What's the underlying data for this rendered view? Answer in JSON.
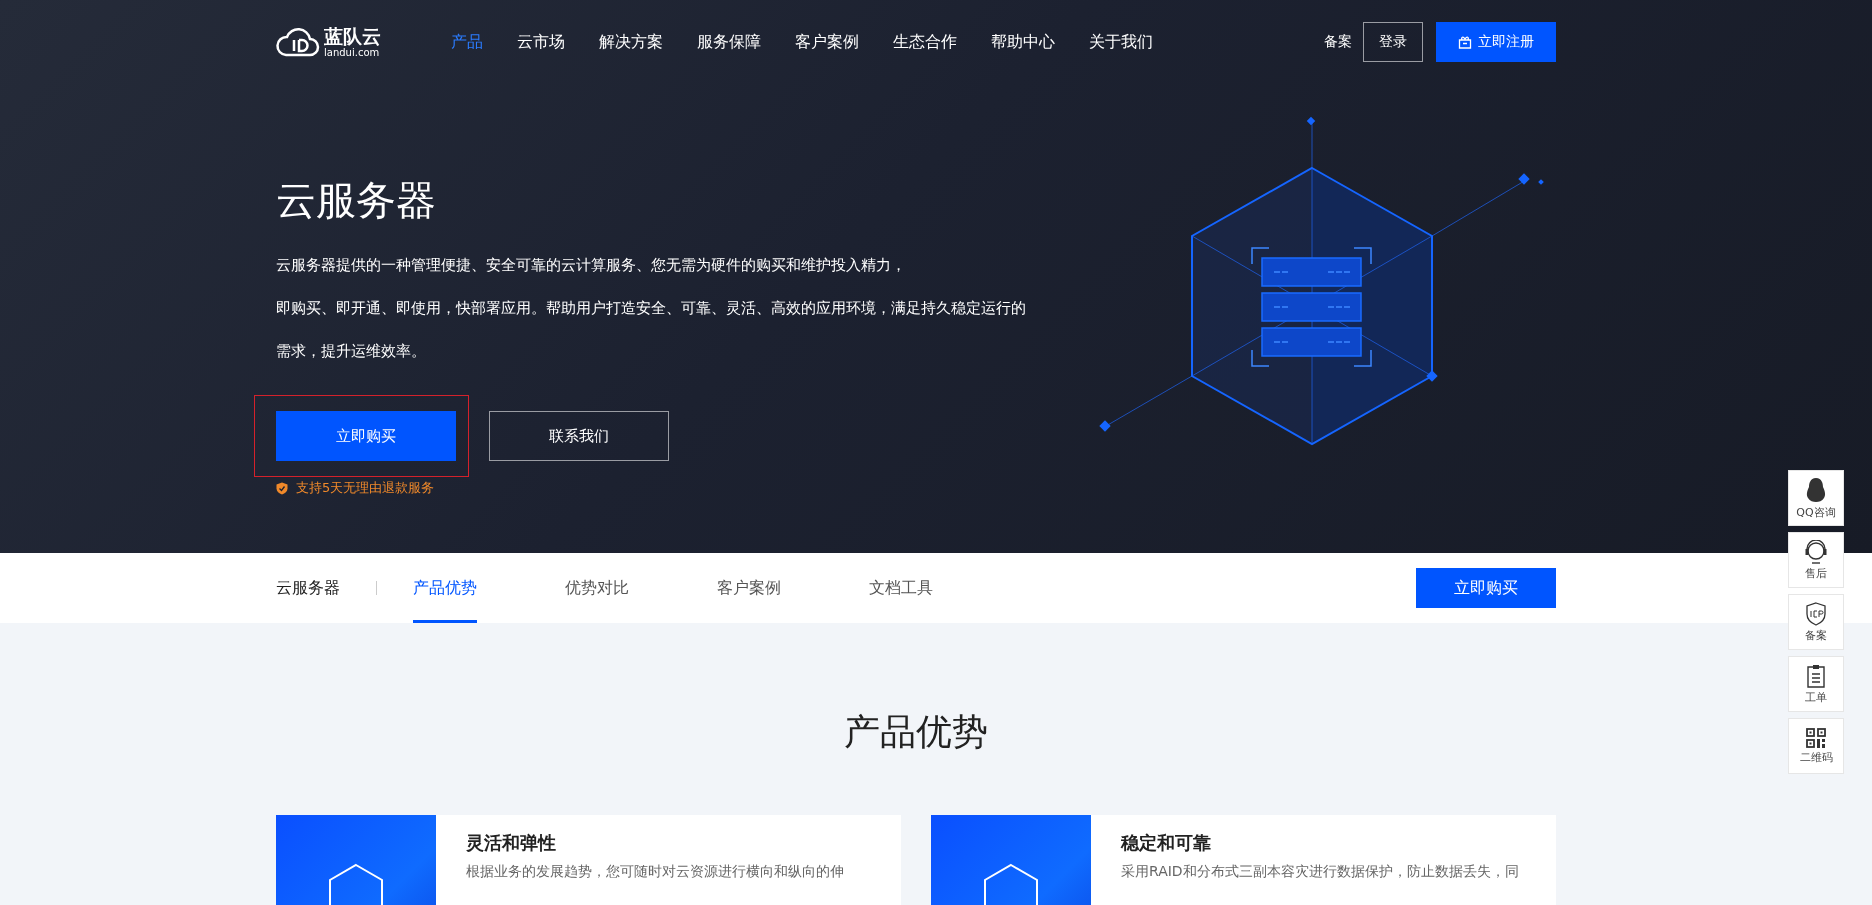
{
  "header": {
    "logo": {
      "name": "蓝队云",
      "domain": "landui.com"
    },
    "nav": [
      {
        "label": "产品",
        "selected": true
      },
      {
        "label": "云市场",
        "selected": false
      },
      {
        "label": "解决方案",
        "selected": false
      },
      {
        "label": "服务保障",
        "selected": false
      },
      {
        "label": "客户案例",
        "selected": false
      },
      {
        "label": "生态合作",
        "selected": false
      },
      {
        "label": "帮助中心",
        "selected": false
      },
      {
        "label": "关于我们",
        "selected": false
      }
    ],
    "filing_link": "备案",
    "login_button": "登录",
    "register_button": "立即注册"
  },
  "hero": {
    "title": "云服务器",
    "description": [
      "云服务器提供的一种管理便捷、安全可靠的云计算服务、您无需为硬件的购买和维护投入精力，",
      "即购买、即开通、即使用，快部署应用。帮助用户打造安全、可靠、灵活、高效的应用环境，满足持久稳定运行的",
      "需求，提升运维效率。"
    ],
    "buy_button": "立即购买",
    "contact_button": "联系我们",
    "guarantee": "支持5天无理由退款服务"
  },
  "subnav": {
    "title": "云服务器",
    "tabs": [
      {
        "label": "产品优势",
        "selected": true
      },
      {
        "label": "优势对比",
        "selected": false
      },
      {
        "label": "客户案例",
        "selected": false
      },
      {
        "label": "文档工具",
        "selected": false
      }
    ],
    "buy_button": "立即购买"
  },
  "section": {
    "heading": "产品优势",
    "cards": [
      {
        "title": "灵活和弹性",
        "text": "根据业务的发展趋势，您可随时对云资源进行横向和纵向的伸"
      },
      {
        "title": "稳定和可靠",
        "text": "采用RAID和分布式三副本容灾进行数据保护，防止数据丢失，同"
      }
    ]
  },
  "side_toolbar": [
    {
      "kind": "qq",
      "label": "QQ咨询"
    },
    {
      "kind": "headset",
      "label": "售后"
    },
    {
      "kind": "icp",
      "label": "备案"
    },
    {
      "kind": "ticket",
      "label": "工单"
    },
    {
      "kind": "qr",
      "label": "二维码"
    }
  ]
}
